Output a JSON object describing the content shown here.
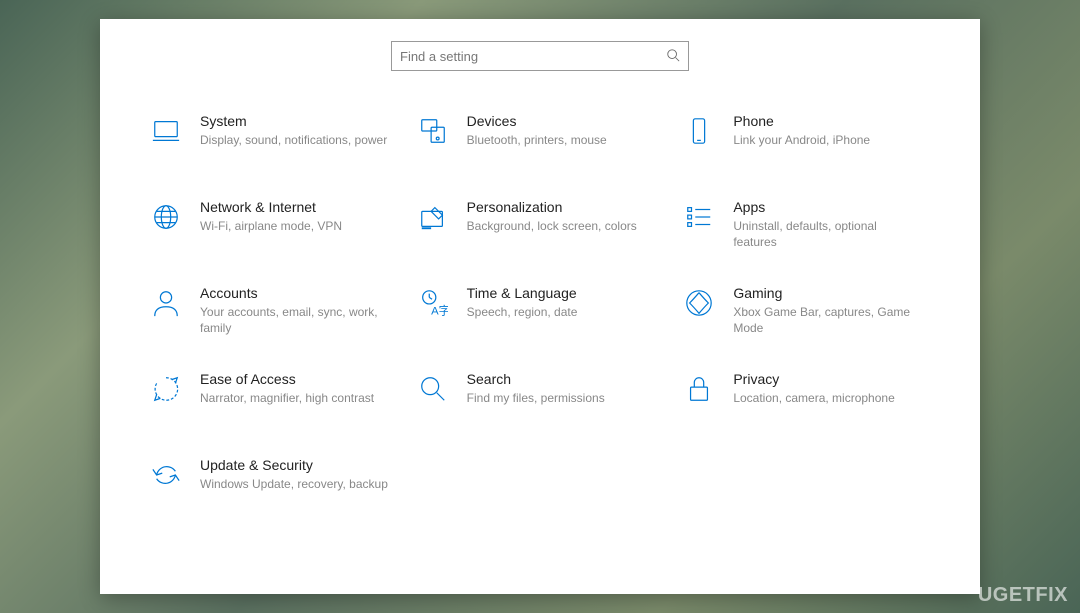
{
  "search": {
    "placeholder": "Find a setting"
  },
  "categories": [
    {
      "title": "System",
      "desc": "Display, sound, notifications, power"
    },
    {
      "title": "Devices",
      "desc": "Bluetooth, printers, mouse"
    },
    {
      "title": "Phone",
      "desc": "Link your Android, iPhone"
    },
    {
      "title": "Network & Internet",
      "desc": "Wi-Fi, airplane mode, VPN"
    },
    {
      "title": "Personalization",
      "desc": "Background, lock screen, colors"
    },
    {
      "title": "Apps",
      "desc": "Uninstall, defaults, optional features"
    },
    {
      "title": "Accounts",
      "desc": "Your accounts, email, sync, work, family"
    },
    {
      "title": "Time & Language",
      "desc": "Speech, region, date"
    },
    {
      "title": "Gaming",
      "desc": "Xbox Game Bar, captures, Game Mode"
    },
    {
      "title": "Ease of Access",
      "desc": "Narrator, magnifier, high contrast"
    },
    {
      "title": "Search",
      "desc": "Find my files, permissions"
    },
    {
      "title": "Privacy",
      "desc": "Location, camera, microphone"
    },
    {
      "title": "Update & Security",
      "desc": "Windows Update, recovery, backup"
    }
  ],
  "accent_color": "#0078d4",
  "watermark": "UGETFIX"
}
